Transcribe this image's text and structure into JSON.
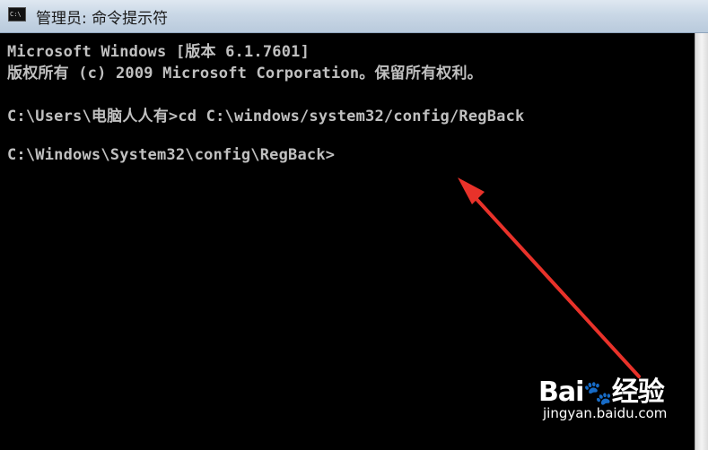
{
  "window": {
    "title": "管理员: 命令提示符",
    "icon": "cmd-icon",
    "icon_text": "C:\\"
  },
  "console": {
    "lines": [
      "Microsoft Windows [版本 6.1.7601]",
      "版权所有 (c) 2009 Microsoft Corporation。保留所有权利。",
      "",
      "C:\\Users\\电脑人人有>cd C:\\windows/system32/config/RegBack",
      "",
      "C:\\Windows\\System32\\config\\RegBack>"
    ],
    "text_color": "#c0c0c0",
    "background": "#000000"
  },
  "annotation": {
    "arrow_color": "#e8322a"
  },
  "watermark": {
    "logo": "Bai",
    "logo_paw": "🐾",
    "logo_suffix": "经验",
    "site": "jingyan.baidu.com"
  }
}
